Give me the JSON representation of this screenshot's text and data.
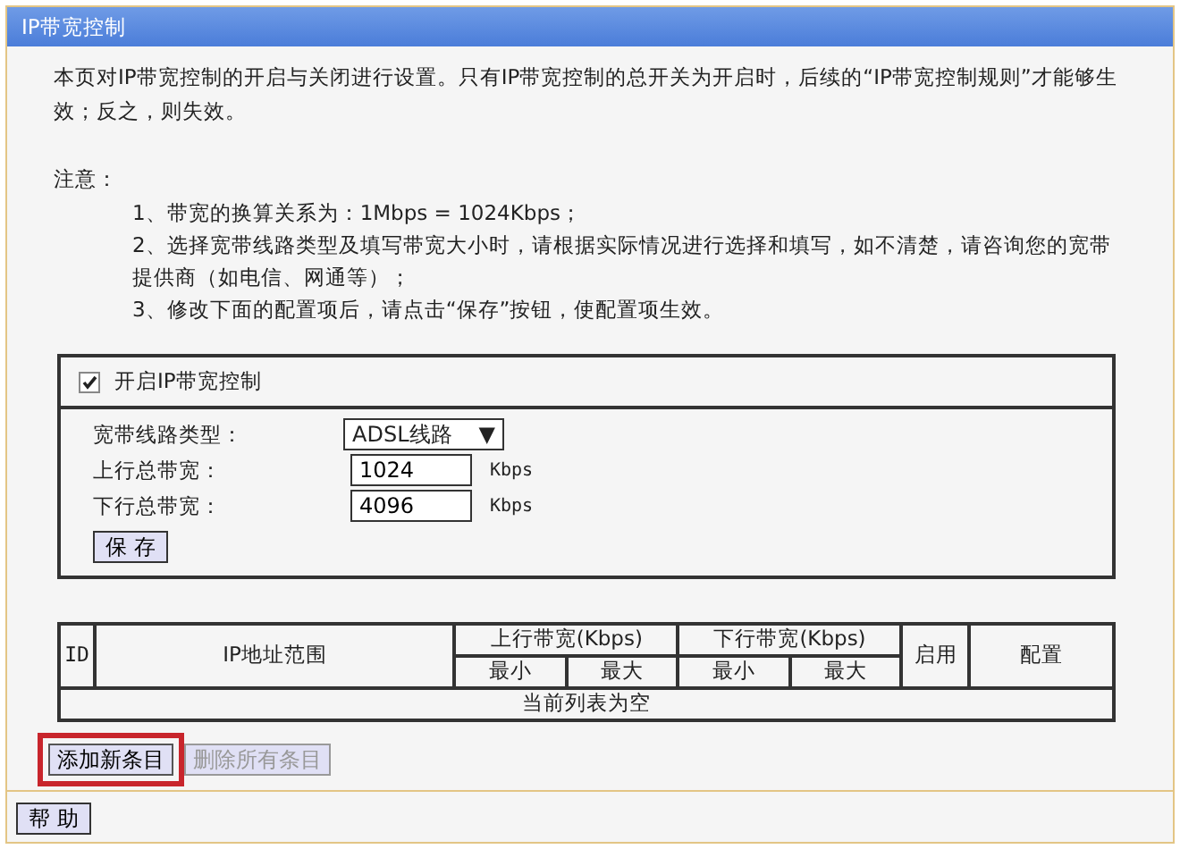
{
  "window": {
    "title": "IP带宽控制"
  },
  "intro": "本页对IP带宽控制的开启与关闭进行设置。只有IP带宽控制的总开关为开启时，后续的“IP带宽控制规则”才能够生效；反之，则失效。",
  "notes": {
    "heading": "注意：",
    "items": [
      "1、带宽的换算关系为：1Mbps = 1024Kbps；",
      "2、选择宽带线路类型及填写带宽大小时，请根据实际情况进行选择和填写，如不清楚，请咨询您的宽带提供商（如电信、网通等）；",
      "3、修改下面的配置项后，请点击“保存”按钮，使配置项生效。"
    ]
  },
  "settings": {
    "enable": {
      "label": "开启IP带宽控制",
      "checked": true
    },
    "fields": [
      {
        "kind": "select",
        "label": "宽带线路类型：",
        "value": "ADSL线路",
        "arrow": "▼"
      },
      {
        "kind": "input",
        "label": "上行总带宽：",
        "value": "1024",
        "unit": "Kbps"
      },
      {
        "kind": "input",
        "label": "下行总带宽：",
        "value": "4096",
        "unit": "Kbps"
      }
    ],
    "save_button": "保 存"
  },
  "table": {
    "columns": {
      "id": "ID",
      "ip_range": "IP地址范围",
      "up": "上行带宽(Kbps)",
      "down": "下行带宽(Kbps)",
      "enabled": "启用",
      "config": "配置",
      "up_sub": [
        "最小",
        "最大"
      ],
      "down_sub": [
        "最小",
        "最大"
      ]
    },
    "empty_text": "当前列表为空"
  },
  "actions": [
    {
      "label": "添加新条目",
      "disabled": false,
      "highlighted": true
    },
    {
      "label": "删除所有条目",
      "disabled": true,
      "highlighted": false
    }
  ],
  "help_button": "帮 助"
}
